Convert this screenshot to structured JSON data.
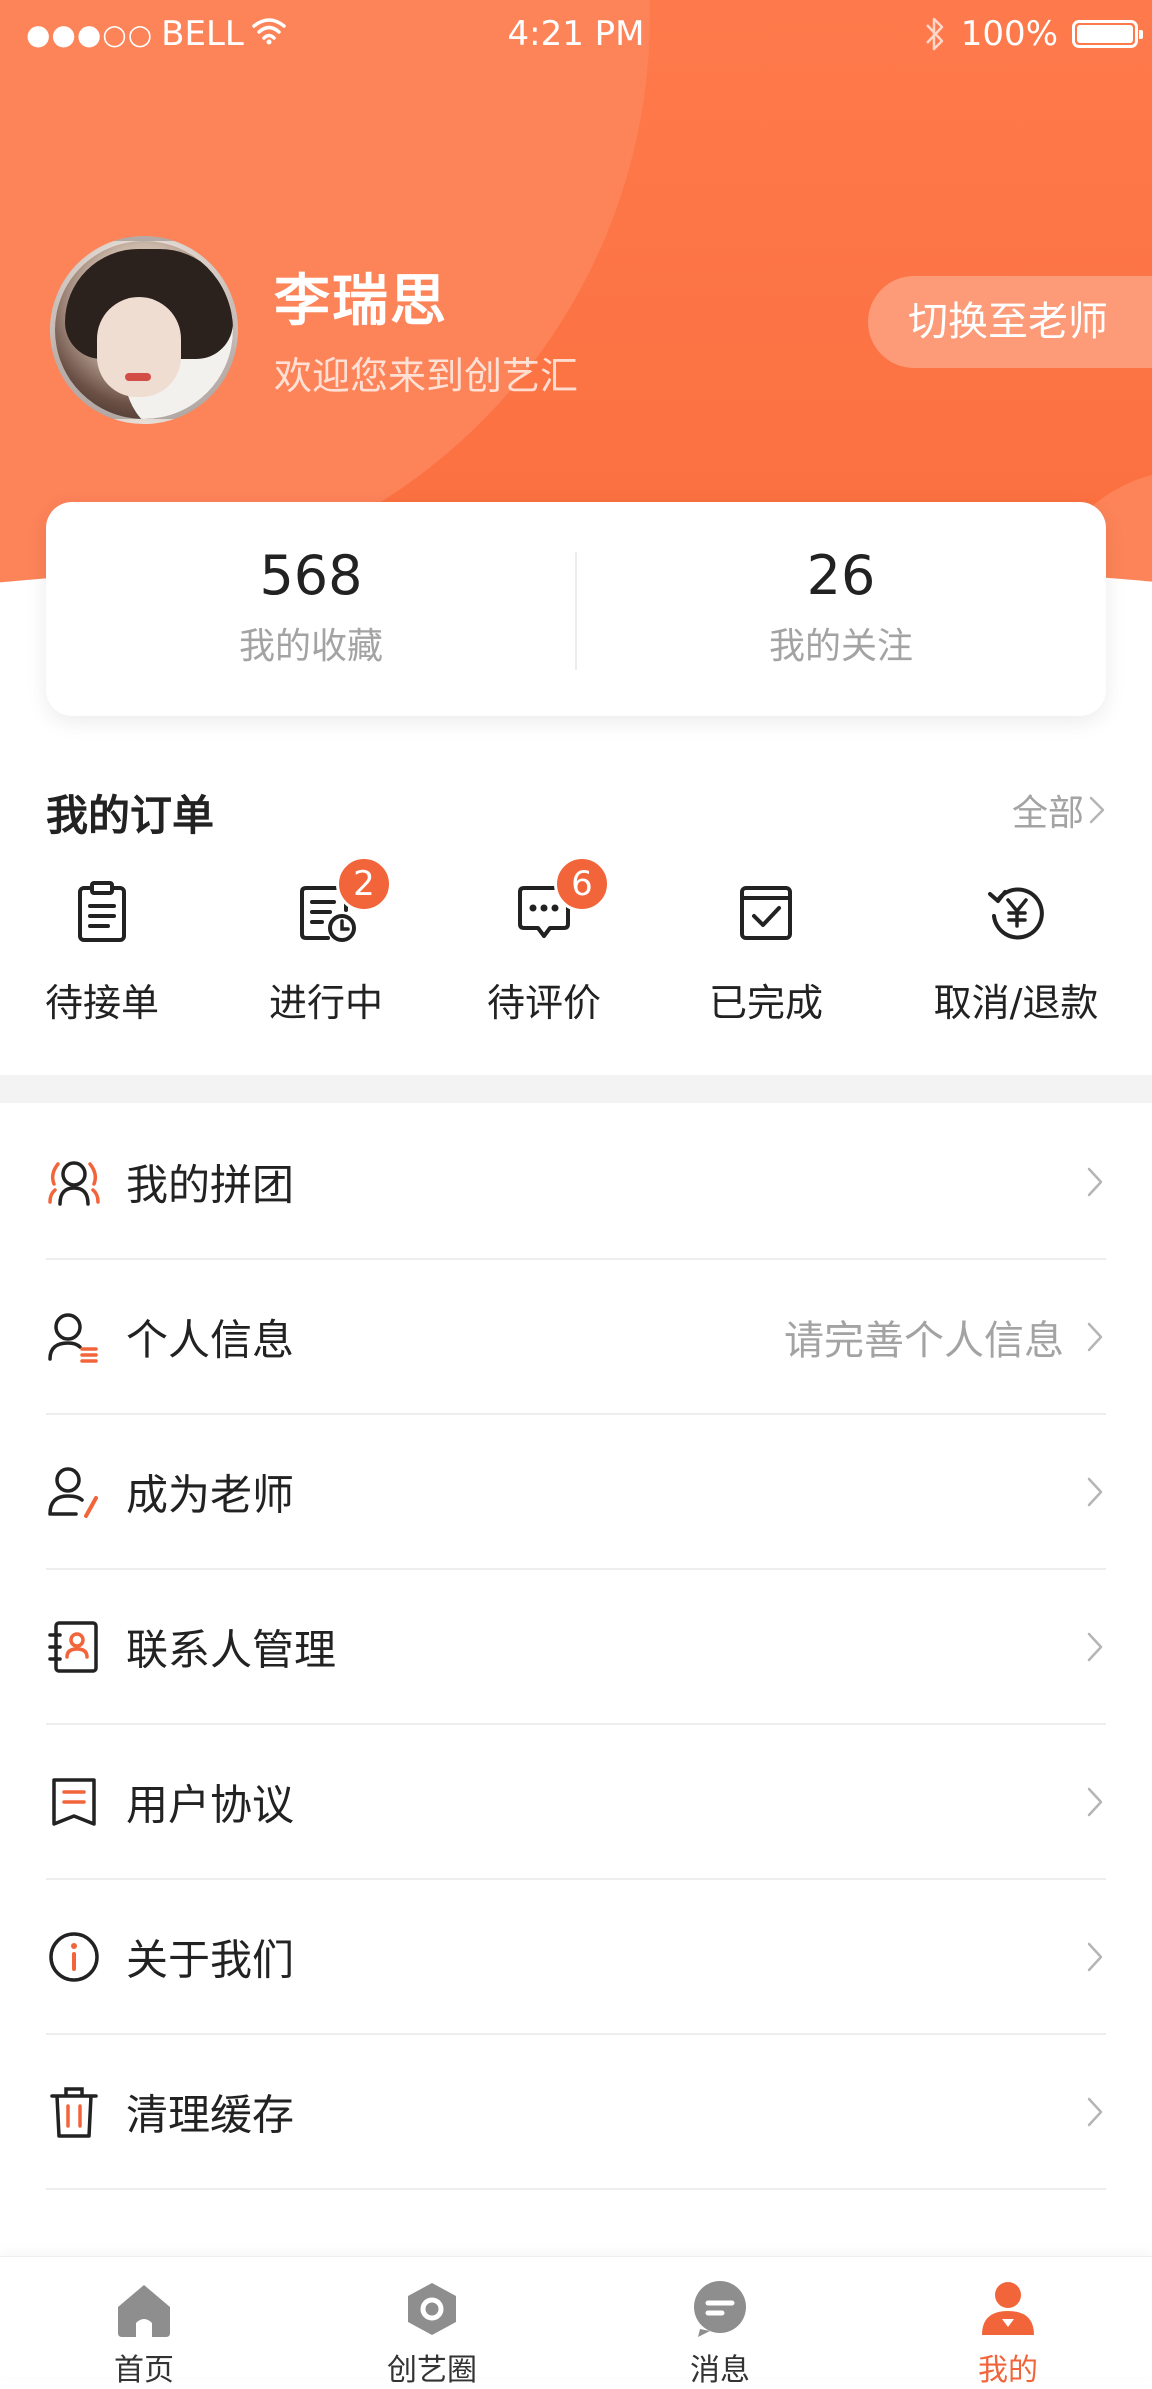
{
  "status_bar": {
    "signal": "●●●○○",
    "carrier": "BELL",
    "time": "4:21 PM",
    "battery": "100%"
  },
  "profile": {
    "name": "李瑞思",
    "welcome": "欢迎您来到创艺汇",
    "switch_button": "切换至老师"
  },
  "stats": [
    {
      "value": "568",
      "label": "我的收藏"
    },
    {
      "value": "26",
      "label": "我的关注"
    }
  ],
  "orders": {
    "title": "我的订单",
    "all_label": "全部",
    "items": [
      {
        "label": "待接单",
        "icon": "clipboard-icon",
        "badge": ""
      },
      {
        "label": "进行中",
        "icon": "in-progress-icon",
        "badge": "2"
      },
      {
        "label": "待评价",
        "icon": "comment-icon",
        "badge": "6"
      },
      {
        "label": "已完成",
        "icon": "completed-icon",
        "badge": ""
      },
      {
        "label": "取消/退款",
        "icon": "refund-icon",
        "badge": ""
      }
    ]
  },
  "menu": [
    {
      "label": "我的拼团",
      "icon": "group-buy-icon",
      "hint": ""
    },
    {
      "label": "个人信息",
      "icon": "personal-info-icon",
      "hint": "请完善个人信息"
    },
    {
      "label": "成为老师",
      "icon": "become-teacher-icon",
      "hint": ""
    },
    {
      "label": "联系人管理",
      "icon": "contacts-icon",
      "hint": ""
    },
    {
      "label": "用户协议",
      "icon": "agreement-icon",
      "hint": ""
    },
    {
      "label": "关于我们",
      "icon": "about-icon",
      "hint": ""
    },
    {
      "label": "清理缓存",
      "icon": "trash-icon",
      "hint": ""
    }
  ],
  "tab_bar": [
    {
      "label": "首页",
      "icon": "home-icon",
      "active": false
    },
    {
      "label": "创艺圈",
      "icon": "circle-icon",
      "active": false
    },
    {
      "label": "消息",
      "icon": "message-icon",
      "active": false
    },
    {
      "label": "我的",
      "icon": "profile-icon",
      "active": true
    }
  ],
  "colors": {
    "accent": "#f2653a",
    "header": "#fe7a4c",
    "muted_text": "#a3a3a3"
  }
}
